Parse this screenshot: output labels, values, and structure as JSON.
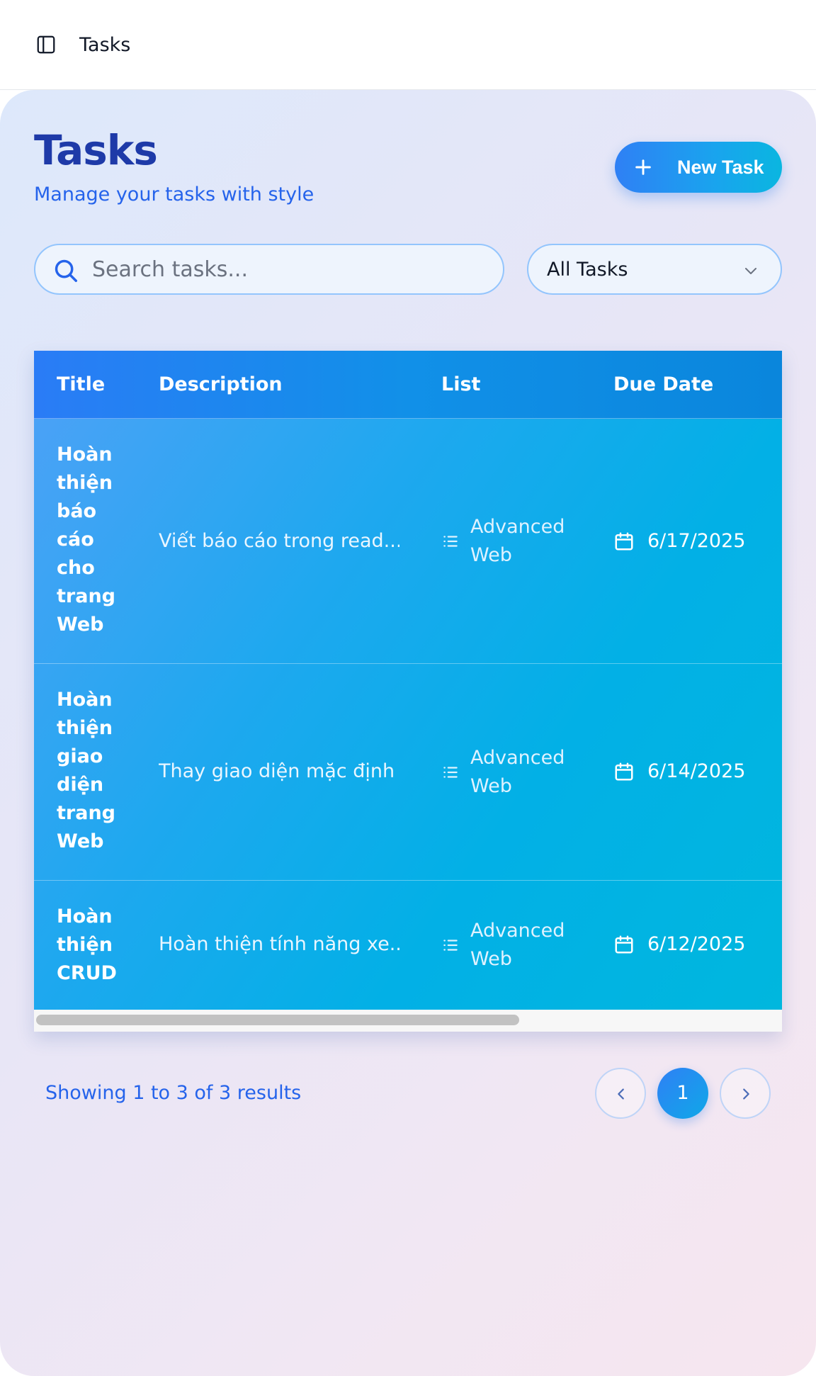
{
  "topbar": {
    "title": "Tasks"
  },
  "header": {
    "title": "Tasks",
    "subtitle": "Manage your tasks with style",
    "new_task_label": "New Task"
  },
  "search": {
    "placeholder": "Search tasks...",
    "value": ""
  },
  "filter": {
    "selected": "All Tasks"
  },
  "table": {
    "columns": [
      "Title",
      "Description",
      "List",
      "Due Date"
    ],
    "rows": [
      {
        "title": "Hoàn thiện báo cáo cho trang Web",
        "description": "Viết báo cáo trong read...",
        "list": "Advanced Web",
        "due": "6/17/2025"
      },
      {
        "title": "Hoàn thiện giao diện trang Web",
        "description": "Thay giao diện mặc định ...",
        "list": "Advanced Web",
        "due": "6/14/2025"
      },
      {
        "title": "Hoàn thiện CRUD",
        "description": "Hoàn thiện tính năng xe...",
        "list": "Advanced Web",
        "due": "6/12/2025"
      }
    ]
  },
  "pagination": {
    "summary": "Showing 1 to 3 of 3 results",
    "current_page": "1"
  },
  "colors": {
    "accent": "#2563eb",
    "title": "#1e3aa8",
    "table_header": "#2a7cf6",
    "table_body": "#00b7de"
  },
  "icons": {
    "sidebar_toggle": "sidebar-panel-icon",
    "new_task": "plus-icon",
    "search": "search-icon",
    "filter": "chevron-down-icon",
    "list": "list-icon",
    "due": "calendar-icon",
    "prev": "chevron-left-icon",
    "next": "chevron-right-icon"
  }
}
